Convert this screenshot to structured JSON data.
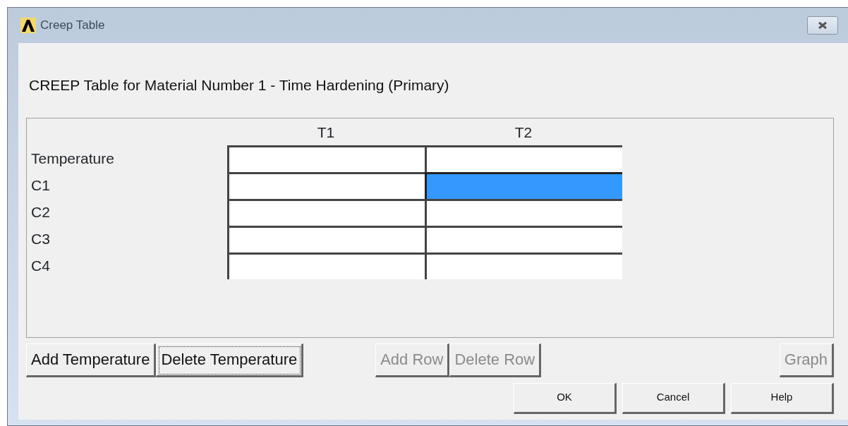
{
  "window": {
    "title": "Creep Table"
  },
  "heading": "CREEP Table for Material Number 1 - Time Hardening (Primary)",
  "table": {
    "columns": [
      "T1",
      "T2"
    ],
    "rows": [
      {
        "label": "Temperature",
        "cells": [
          {
            "selected": false
          },
          {
            "selected": false
          }
        ]
      },
      {
        "label": "C1",
        "cells": [
          {
            "selected": false
          },
          {
            "selected": true
          }
        ]
      },
      {
        "label": "C2",
        "cells": [
          {
            "selected": false
          },
          {
            "selected": false
          }
        ]
      },
      {
        "label": "C3",
        "cells": [
          {
            "selected": false
          },
          {
            "selected": false
          }
        ]
      },
      {
        "label": "C4",
        "cells": [
          {
            "selected": false
          },
          {
            "selected": false
          }
        ]
      }
    ]
  },
  "table_button_groups": [
    {
      "buttons": [
        {
          "label": "Add Temperature",
          "disabled": false,
          "focused": false
        },
        {
          "label": "Delete Temperature",
          "disabled": false,
          "focused": true
        }
      ]
    },
    {
      "buttons": [
        {
          "label": "Add Row",
          "disabled": true,
          "focused": false
        },
        {
          "label": "Delete Row",
          "disabled": true,
          "focused": false
        }
      ]
    },
    {
      "buttons": [
        {
          "label": "Graph",
          "disabled": true,
          "focused": false
        }
      ]
    }
  ],
  "dialog_buttons": [
    "OK",
    "Cancel",
    "Help"
  ]
}
